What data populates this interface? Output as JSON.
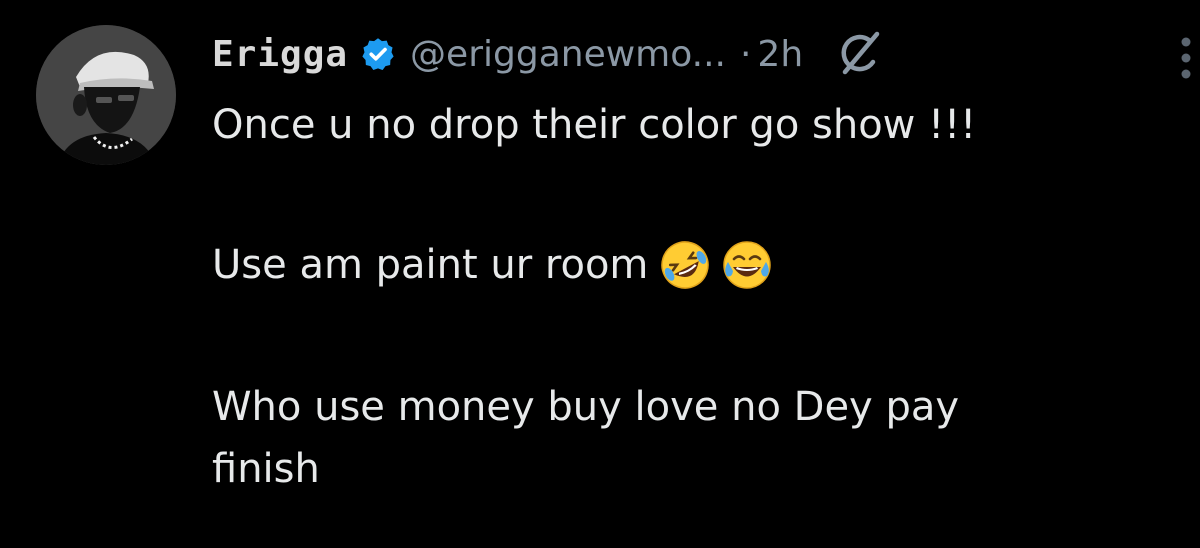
{
  "tweet": {
    "author": {
      "display_name": "Erigga",
      "handle": "@erigganewmo...",
      "verified": true,
      "avatar_icon": "user-avatar"
    },
    "separator": "·",
    "timestamp": "2h",
    "actions": {
      "grok_icon": "grok-icon",
      "more_icon": "more-vertical-icon"
    },
    "body": {
      "line1": "Once u no drop their color go show !!!",
      "line2": "Use am paint ur room",
      "line2_emojis": [
        "rolling-on-floor-laughing-emoji",
        "tears-of-joy-emoji"
      ],
      "line3": "Who use money buy love no Dey pay",
      "line4": "finish"
    }
  },
  "colors": {
    "background": "#000000",
    "text": "#e7e9ea",
    "muted": "#8b98a5",
    "verified_badge": "#1d9bf0"
  }
}
